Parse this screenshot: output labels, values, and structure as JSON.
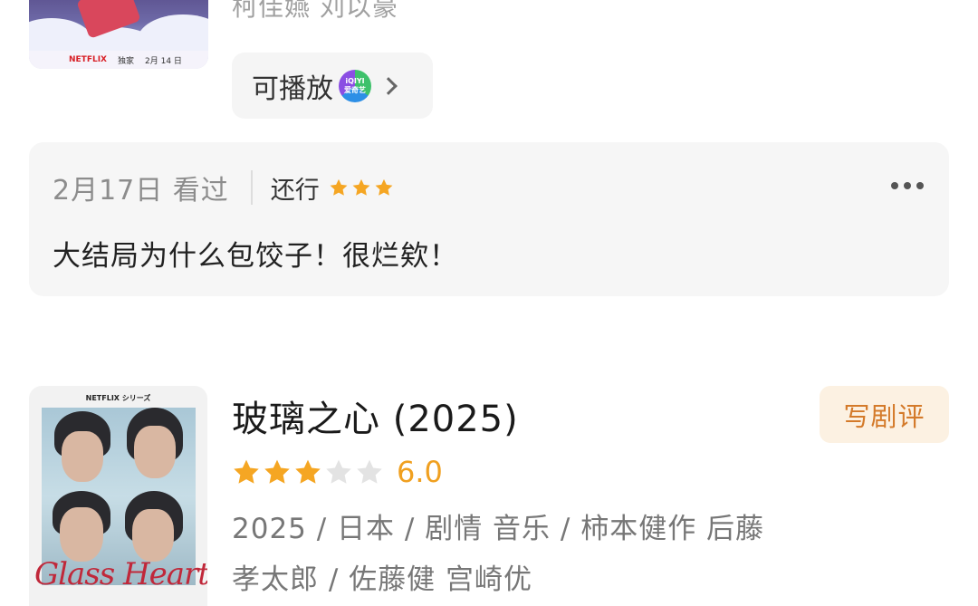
{
  "top_item": {
    "cast": "柯佳嬿 刘以豪",
    "poster_strip": {
      "brand": "NETFLIX",
      "tag": "独家",
      "date": "2月 14 日"
    },
    "play_button": {
      "label": "可播放",
      "platform_icon": "iqiyi-icon",
      "platform_text_top": "iQIYI",
      "platform_text_bottom": "爱奇艺"
    }
  },
  "review": {
    "date_status": "2月17日 看过",
    "rating_text": "还行",
    "stars": 3,
    "text": "大结局为什么包饺子！很烂欸！",
    "more_icon": "more-horizontal-icon"
  },
  "movie": {
    "poster_brand": "NETFLIX シリーズ",
    "poster_script": "Glass Heart",
    "title": "玻璃之心 (2025)",
    "stars": 3,
    "stars_max": 5,
    "score": "6.0",
    "meta_line1": "2025 / 日本 / 剧情 音乐 / 柿本健作 后藤",
    "meta_line2": "孝太郎 / 佐藤健 宫崎优",
    "write_review_label": "写剧评"
  },
  "colors": {
    "star_filled": "#f5a623",
    "star_empty": "#e3e3e3",
    "accent_orange": "#d47a2a",
    "accent_bg": "#fcf1e2"
  }
}
